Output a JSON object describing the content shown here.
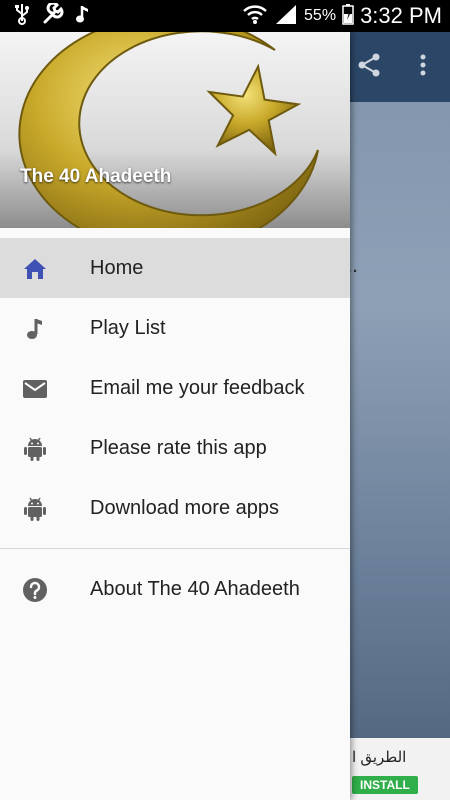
{
  "status_bar": {
    "battery_percent": "55%",
    "time": "3:32 PM",
    "icons": [
      "usb-icon",
      "wrench-icon",
      "music-note-icon",
      "wifi-icon",
      "signal-icon",
      "battery-icon"
    ]
  },
  "background_app": {
    "partial_text": "k...",
    "ad": {
      "text": "الطريق ا",
      "install_label": "INSTALL"
    }
  },
  "drawer": {
    "header_title": "The 40 Ahadeeth",
    "items": [
      {
        "label": "Home",
        "icon": "home-icon",
        "selected": true
      },
      {
        "label": "Play List",
        "icon": "music-note-icon",
        "selected": false
      },
      {
        "label": "Email me your feedback",
        "icon": "mail-icon",
        "selected": false
      },
      {
        "label": "Please rate this app",
        "icon": "android-icon",
        "selected": false
      },
      {
        "label": "Download more apps",
        "icon": "android-icon",
        "selected": false
      }
    ],
    "secondary_items": [
      {
        "label": "About The 40 Ahadeeth",
        "icon": "help-icon"
      }
    ],
    "colors": {
      "selected_bg": "#dcdcdc",
      "home_icon": "#3f51b5",
      "icon_gray": "#616161"
    }
  }
}
